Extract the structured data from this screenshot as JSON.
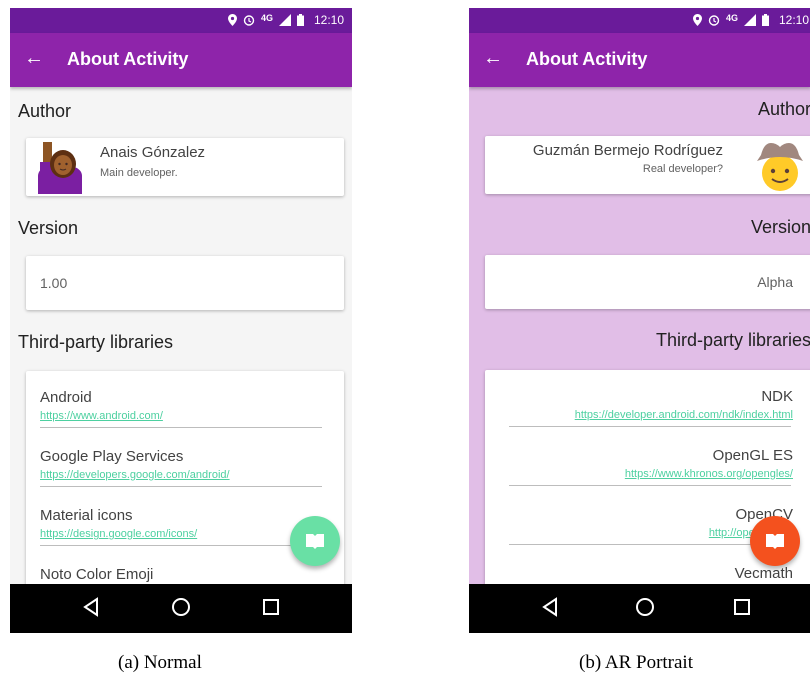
{
  "colors": {
    "status_bar": "#6a1b9a",
    "app_bar": "#8e24aa",
    "ar_background": "#e1bee7",
    "link": "#4dd0a0",
    "fab_normal": "#69e0a5",
    "fab_ar": "#f4511e"
  },
  "status_bar": {
    "network": "4G",
    "time": "12:10",
    "icons": [
      "location-icon",
      "alarm-icon",
      "signal-icon",
      "battery-icon"
    ]
  },
  "app_bar": {
    "back_icon": "arrow-back-icon",
    "title": "About Activity"
  },
  "nav_bar": {
    "icons": [
      "back-triangle-icon",
      "home-circle-icon",
      "recents-square-icon"
    ]
  },
  "normal": {
    "author_label": "Author",
    "author_name": "Anais Gónzalez",
    "author_role": "Main developer.",
    "version_label": "Version",
    "version_value": "1.00",
    "libraries_label": "Third-party libraries",
    "libraries": [
      {
        "name": "Android",
        "url": "https://www.android.com/"
      },
      {
        "name": "Google Play Services",
        "url": "https://developers.google.com/android/"
      },
      {
        "name": "Material icons",
        "url": "https://design.google.com/icons/"
      },
      {
        "name": "Noto Color Emoji",
        "url": ""
      }
    ],
    "fab_icon": "book-icon",
    "caption": "(a) Normal"
  },
  "ar": {
    "author_label": "Author",
    "author_name": "Guzmán Bermejo Rodríguez",
    "author_role": "Real developer?",
    "version_label": "Version",
    "version_value": "Alpha",
    "libraries_label": "Third-party libraries",
    "libraries": [
      {
        "name": "NDK",
        "url": "https://developer.android.com/ndk/index.html"
      },
      {
        "name": "OpenGL ES",
        "url": "https://www.khronos.org/opengles/"
      },
      {
        "name": "OpenCV",
        "url": "http://opencv.org/"
      },
      {
        "name": "Vecmath",
        "url": ""
      }
    ],
    "fab_icon": "book-icon",
    "caption": "(b) AR Portrait"
  }
}
